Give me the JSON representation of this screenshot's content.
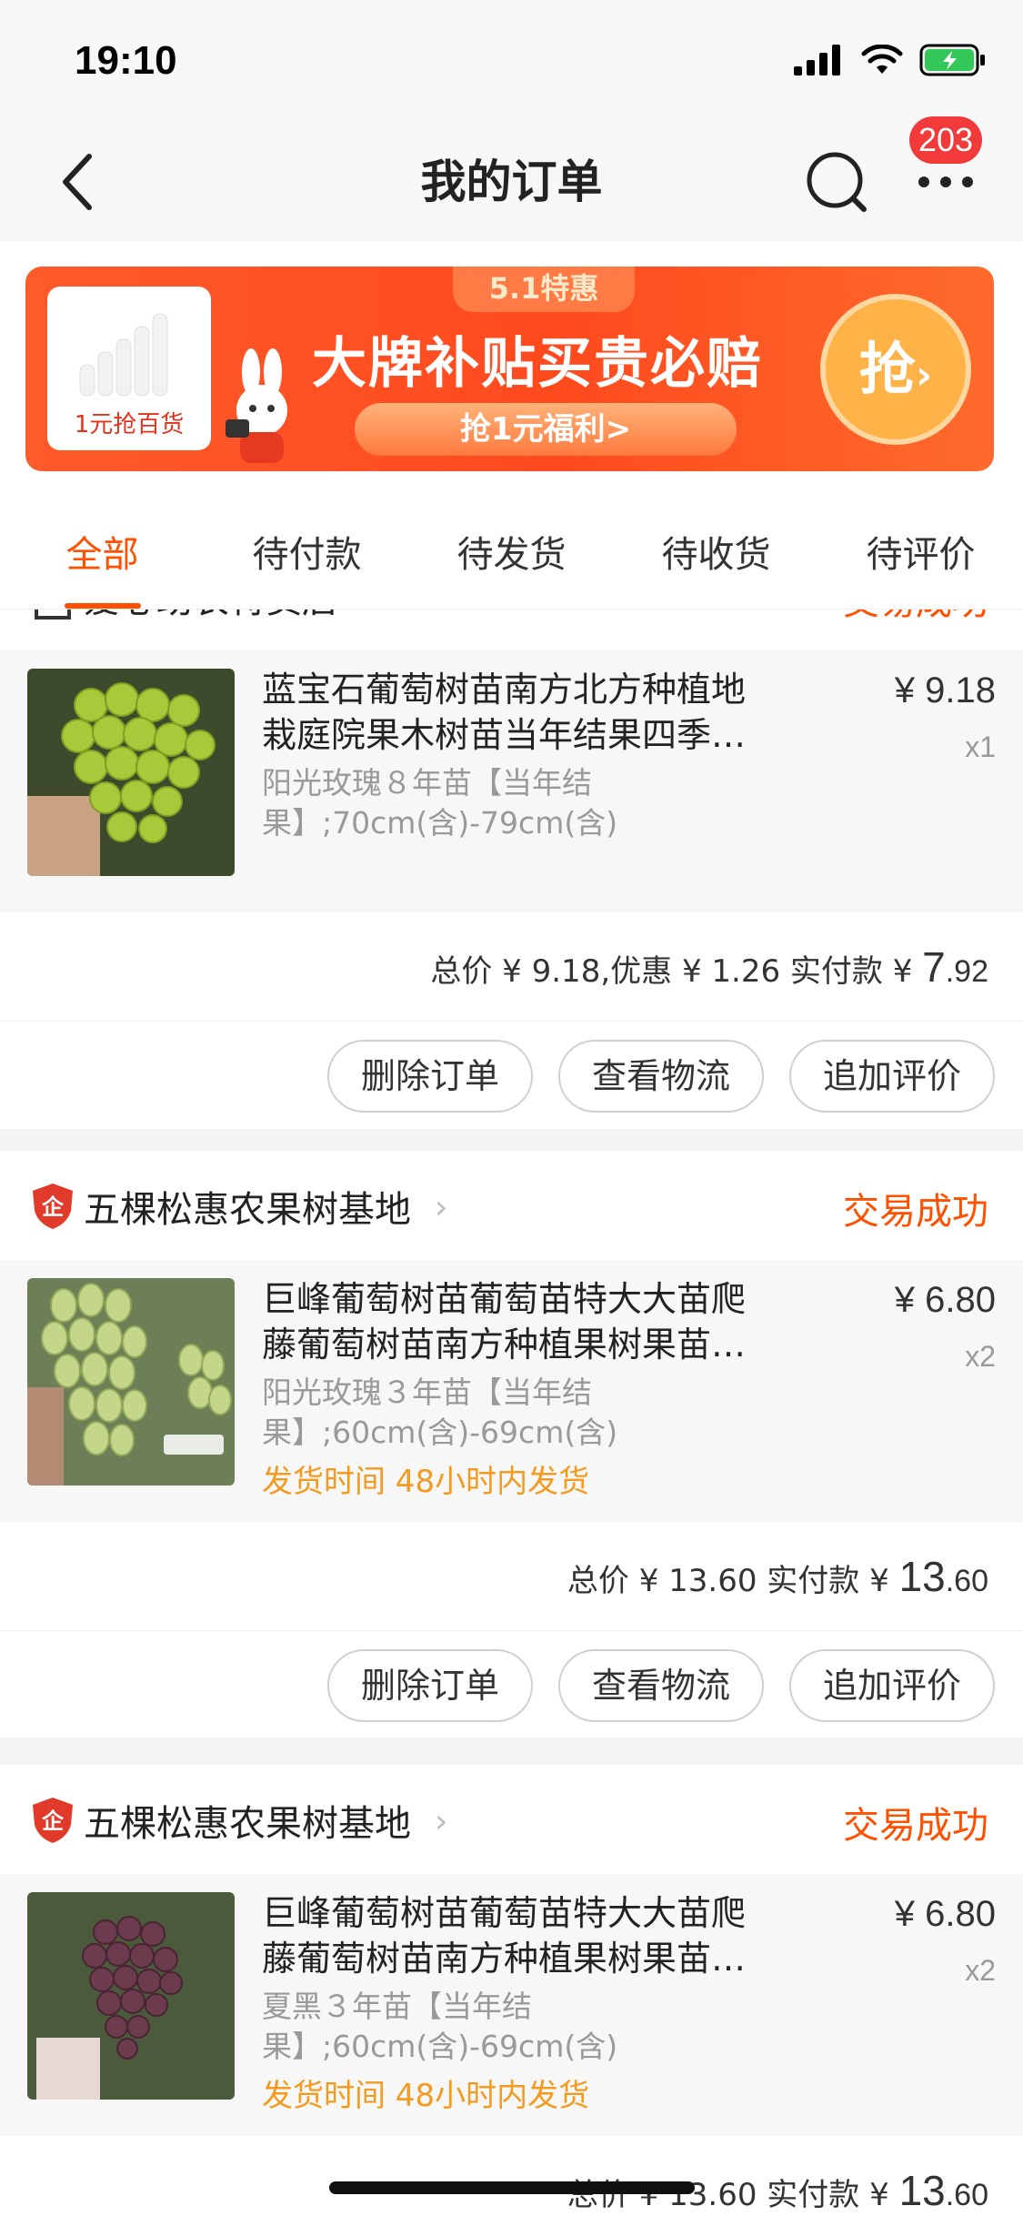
{
  "status_bar": {
    "time": "19:10"
  },
  "nav": {
    "title": "我的订单",
    "badge_count": "203"
  },
  "banner": {
    "card_label": "1元抢百货",
    "tag": "5.1特惠",
    "headline": "大牌补贴买贵必赔",
    "pill": "抢1元福利>",
    "cta": "抢"
  },
  "tabs": [
    {
      "label": "全部",
      "active": true
    },
    {
      "label": "待付款"
    },
    {
      "label": "待发货"
    },
    {
      "label": "待收货"
    },
    {
      "label": "待评价"
    }
  ],
  "orders": [
    {
      "shop": "爱心助农特卖店",
      "status": "交易成功",
      "item": {
        "title": "蓝宝石葡萄树苗南方北方种植地栽庭院果木树苗当年结果四季…",
        "sku": "阳光玫瑰８年苗【当年结果】;70cm(含)-79cm(含)",
        "price": "¥ 9.18",
        "qty": "x1"
      },
      "totals": {
        "prefix": "总价 ¥ 9.18,优惠 ¥ 1.26 实付款 ¥ ",
        "big": "7",
        "small": ".92"
      },
      "actions": [
        "删除订单",
        "查看物流",
        "追加评价"
      ]
    },
    {
      "shop": "五棵松惠农果树基地",
      "status": "交易成功",
      "item": {
        "title": "巨峰葡萄树苗葡萄苗特大大苗爬藤葡萄树苗南方种植果树果苗…",
        "sku": "阳光玫瑰３年苗【当年结果】;60cm(含)-69cm(含)",
        "ship": "发货时间 48小时内发货",
        "price": "¥ 6.80",
        "qty": "x2"
      },
      "totals": {
        "prefix": "总价 ¥ 13.60 实付款 ¥ ",
        "big": "13",
        "small": ".60"
      },
      "actions": [
        "删除订单",
        "查看物流",
        "追加评价"
      ]
    },
    {
      "shop": "五棵松惠农果树基地",
      "status": "交易成功",
      "item": {
        "title": "巨峰葡萄树苗葡萄苗特大大苗爬藤葡萄树苗南方种植果树果苗…",
        "sku": "夏黑３年苗【当年结果】;60cm(含)-69cm(含)",
        "ship": "发货时间 48小时内发货",
        "price": "¥ 6.80",
        "qty": "x2"
      },
      "totals": {
        "prefix": "总价 ¥ 13.60 实付款 ¥ ",
        "big": "13",
        "small": ".60"
      }
    }
  ],
  "colors": {
    "accent": "#ff5000",
    "ship": "#f39a1f",
    "badge": "#f23a3a"
  }
}
